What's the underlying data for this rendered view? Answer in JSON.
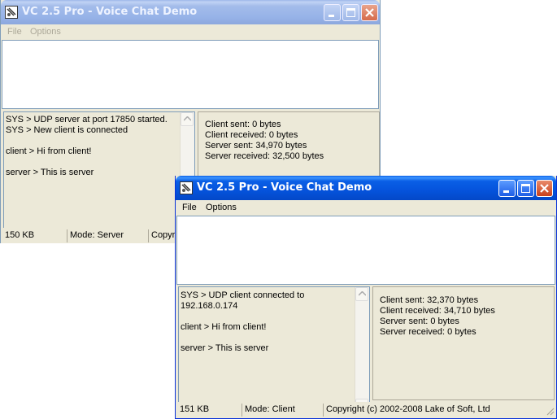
{
  "server_window": {
    "title": "VC 2.5 Pro - Voice Chat Demo",
    "menu": [
      "File",
      "Options"
    ],
    "log": [
      "SYS > UDP server at port 17850 started.",
      "SYS > New client is connected",
      "",
      "client > Hi from client!",
      "",
      "server > This is server"
    ],
    "stats": {
      "client_sent": "Client sent: 0 bytes",
      "client_received": "Client received: 0 bytes",
      "server_sent": "Server sent: 34,970 bytes",
      "server_received": "Server received: 32,500 bytes"
    },
    "status": {
      "size": "150 KB",
      "mode": "Mode: Server",
      "copyright": "Copyr"
    }
  },
  "client_window": {
    "title": "VC 2.5 Pro - Voice Chat Demo",
    "menu": [
      "File",
      "Options"
    ],
    "log": [
      "SYS > UDP client connected to",
      "192.168.0.174",
      "",
      "client > Hi from client!",
      "",
      "server > This is server"
    ],
    "stats": {
      "client_sent": "Client sent: 32,370 bytes",
      "client_received": "Client received: 34,710 bytes",
      "server_sent": "Server sent: 0 bytes",
      "server_received": "Server received: 0 bytes"
    },
    "status": {
      "size": "151 KB",
      "mode": "Mode: Client",
      "copyright": "Copyright (c) 2002-2008 Lake of Soft, Ltd"
    }
  },
  "colors": {
    "titlebar_active": "#0553dc",
    "titlebar_inactive": "#97b3e8",
    "window_face": "#ece9d8",
    "close_button": "#c9401c"
  },
  "icons": [
    "app-icon",
    "minimize-icon",
    "maximize-icon",
    "close-icon",
    "scroll-up-icon",
    "scroll-down-icon",
    "size-grip-icon"
  ]
}
